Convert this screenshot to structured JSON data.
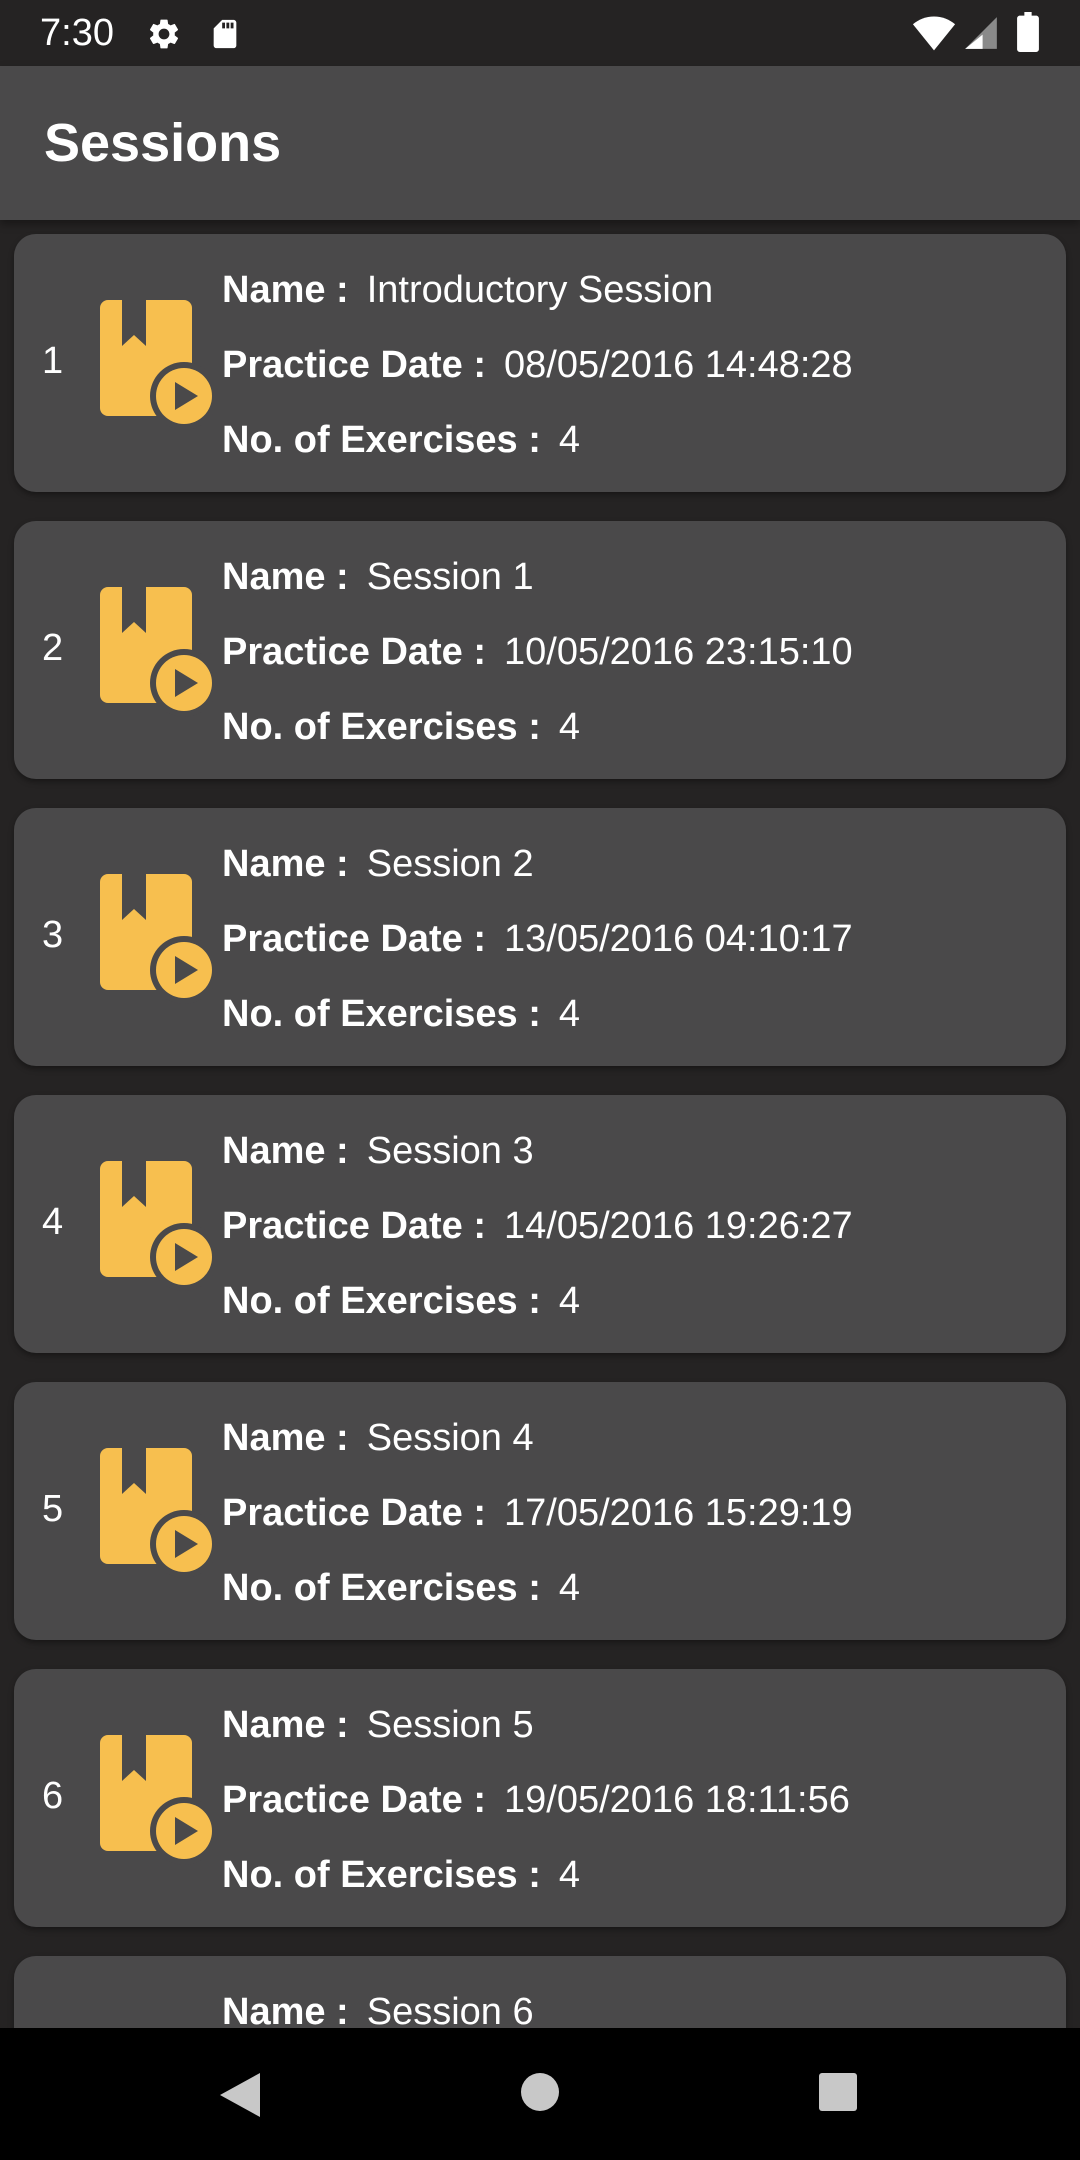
{
  "status_bar": {
    "time": "7:30",
    "left_icons": [
      "settings-icon",
      "sd-card-icon"
    ],
    "right_icons": [
      "wifi-icon",
      "cell-signal-icon",
      "battery-icon"
    ]
  },
  "app_bar": {
    "title": "Sessions"
  },
  "labels": {
    "name": "Name :",
    "practice_date": "Practice Date :",
    "exercises": "No. of Exercises :"
  },
  "sessions": [
    {
      "index": "1",
      "name": "Introductory Session",
      "practice_date": "08/05/2016 14:48:28",
      "exercises": "4"
    },
    {
      "index": "2",
      "name": "Session 1",
      "practice_date": "10/05/2016 23:15:10",
      "exercises": "4"
    },
    {
      "index": "3",
      "name": "Session 2",
      "practice_date": "13/05/2016 04:10:17",
      "exercises": "4"
    },
    {
      "index": "4",
      "name": "Session 3",
      "practice_date": "14/05/2016 19:26:27",
      "exercises": "4"
    },
    {
      "index": "5",
      "name": "Session 4",
      "practice_date": "17/05/2016 15:29:19",
      "exercises": "4"
    },
    {
      "index": "6",
      "name": "Session 5",
      "practice_date": "19/05/2016 18:11:56",
      "exercises": "4"
    },
    {
      "name": "Session 6"
    }
  ],
  "session_icon": "bookmark-play-icon",
  "nav_bar": {
    "buttons": [
      "back-icon",
      "home-icon",
      "recents-icon"
    ]
  },
  "colors": {
    "background": "#252323",
    "card": "#4a494a",
    "app_bar": "#4a494a",
    "accent": "#f7bf4f",
    "text": "#ffffff"
  }
}
